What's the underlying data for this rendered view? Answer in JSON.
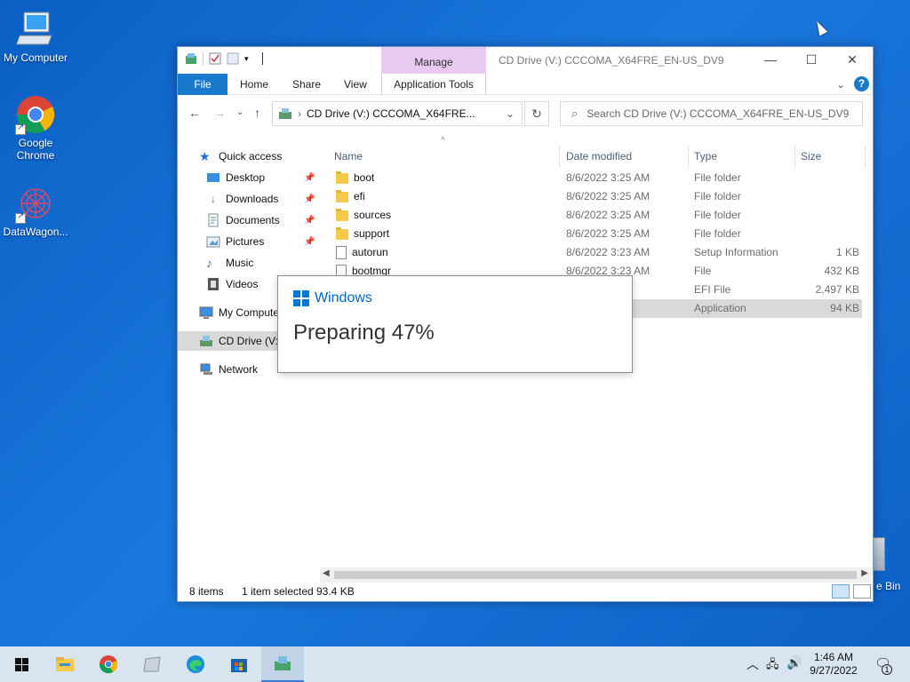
{
  "desktop": {
    "icons": [
      {
        "label": "My Computer",
        "icon": "monitor-icon"
      },
      {
        "label": "Google\nChrome",
        "icon": "chrome-icon"
      },
      {
        "label": "DataWagon...",
        "icon": "datawagon-icon"
      }
    ],
    "recycle_bin_label": "e Bin"
  },
  "window": {
    "title": "CD Drive (V:) CCCOMA_X64FRE_EN-US_DV9",
    "contextual_tab": "Manage",
    "ribbon_tabs": [
      "File",
      "Home",
      "Share",
      "View",
      "Application Tools"
    ],
    "address": "CD Drive (V:) CCCOMA_X64FRE...",
    "search_placeholder": "Search CD Drive (V:) CCCOMA_X64FRE_EN-US_DV9",
    "nav": [
      {
        "label": "Quick access",
        "icon": "star-icon"
      },
      {
        "label": "Desktop",
        "icon": "desktop-icon",
        "pinned": true
      },
      {
        "label": "Downloads",
        "icon": "download-icon",
        "pinned": true
      },
      {
        "label": "Documents",
        "icon": "documents-icon",
        "pinned": true
      },
      {
        "label": "Pictures",
        "icon": "pictures-icon",
        "pinned": true
      },
      {
        "label": "Music",
        "icon": "music-icon"
      },
      {
        "label": "Videos",
        "icon": "videos-icon"
      },
      {
        "label": "My Compute",
        "icon": "computer-icon"
      },
      {
        "label": "CD Drive (V:)",
        "icon": "cd-drive-icon",
        "selected": true
      },
      {
        "label": "Network",
        "icon": "network-icon"
      }
    ],
    "columns": {
      "name": "Name",
      "date": "Date modified",
      "type": "Type",
      "size": "Size"
    },
    "files": [
      {
        "name": "boot",
        "date": "8/6/2022 3:25 AM",
        "type": "File folder",
        "size": "",
        "kind": "folder"
      },
      {
        "name": "efi",
        "date": "8/6/2022 3:25 AM",
        "type": "File folder",
        "size": "",
        "kind": "folder"
      },
      {
        "name": "sources",
        "date": "8/6/2022 3:25 AM",
        "type": "File folder",
        "size": "",
        "kind": "folder"
      },
      {
        "name": "support",
        "date": "8/6/2022 3:25 AM",
        "type": "File folder",
        "size": "",
        "kind": "folder"
      },
      {
        "name": "autorun",
        "date": "8/6/2022 3:23 AM",
        "type": "Setup Information",
        "size": "1 KB",
        "kind": "file"
      },
      {
        "name": "bootmgr",
        "date": "8/6/2022 3:23 AM",
        "type": "File",
        "size": "432 KB",
        "kind": "file"
      },
      {
        "name": "",
        "date": "AM",
        "type": "EFI File",
        "size": "2,497 KB",
        "kind": "file"
      },
      {
        "name": "",
        "date": "AM",
        "type": "Application",
        "size": "94 KB",
        "kind": "file",
        "selected": true
      }
    ],
    "status": {
      "items": "8 items",
      "selected": "1 item selected",
      "size": "93.4 KB"
    }
  },
  "dialog": {
    "brand": "Windows",
    "progress_text": "Preparing 47%",
    "progress_percent": 47
  },
  "taskbar": {
    "apps": [
      "start-icon",
      "file-explorer-icon",
      "chrome-icon",
      "app-icon",
      "edge-icon",
      "store-icon",
      "setup-icon"
    ],
    "time": "1:46 AM",
    "date": "9/27/2022",
    "notification_count": "1"
  },
  "colors": {
    "accent": "#1979ca",
    "manage_tab": "#e9c8f2",
    "desktop": "#1a78dc"
  }
}
